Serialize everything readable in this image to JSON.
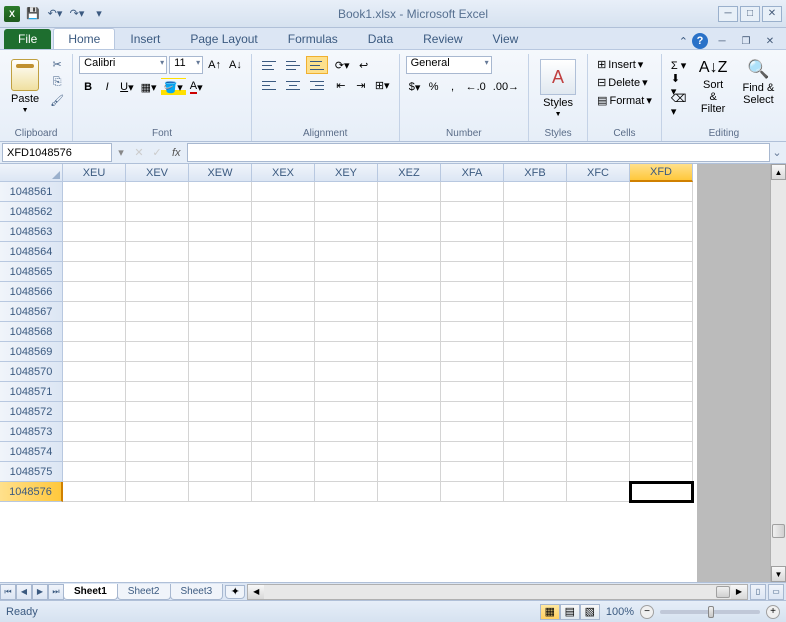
{
  "title": "Book1.xlsx - Microsoft Excel",
  "tabs": {
    "file": "File",
    "list": [
      "Home",
      "Insert",
      "Page Layout",
      "Formulas",
      "Data",
      "Review",
      "View"
    ],
    "active": "Home"
  },
  "ribbon": {
    "clipboard": {
      "label": "Clipboard",
      "paste": "Paste"
    },
    "font": {
      "label": "Font",
      "name": "Calibri",
      "size": "11",
      "bold": "B",
      "italic": "I",
      "underline": "U"
    },
    "alignment": {
      "label": "Alignment"
    },
    "number": {
      "label": "Number",
      "format": "General",
      "currency": "$",
      "percent": "%",
      "comma": ",",
      "inc": ".0",
      "dec": ".00"
    },
    "styles": {
      "label": "Styles",
      "btn": "Styles"
    },
    "cells": {
      "label": "Cells",
      "insert": "Insert",
      "delete": "Delete",
      "format": "Format"
    },
    "editing": {
      "label": "Editing",
      "sort": "Sort & Filter",
      "find": "Find & Select"
    }
  },
  "formula_bar": {
    "name_box": "XFD1048576",
    "fx": "fx",
    "value": ""
  },
  "grid": {
    "columns": [
      "XEU",
      "XEV",
      "XEW",
      "XEX",
      "XEY",
      "XEZ",
      "XFA",
      "XFB",
      "XFC",
      "XFD"
    ],
    "selected_col": "XFD",
    "rows": [
      "1048561",
      "1048562",
      "1048563",
      "1048564",
      "1048565",
      "1048566",
      "1048567",
      "1048568",
      "1048569",
      "1048570",
      "1048571",
      "1048572",
      "1048573",
      "1048574",
      "1048575",
      "1048576"
    ],
    "selected_row": "1048576"
  },
  "sheets": {
    "list": [
      "Sheet1",
      "Sheet2",
      "Sheet3"
    ],
    "active": "Sheet1"
  },
  "status": {
    "ready": "Ready",
    "zoom": "100%"
  }
}
